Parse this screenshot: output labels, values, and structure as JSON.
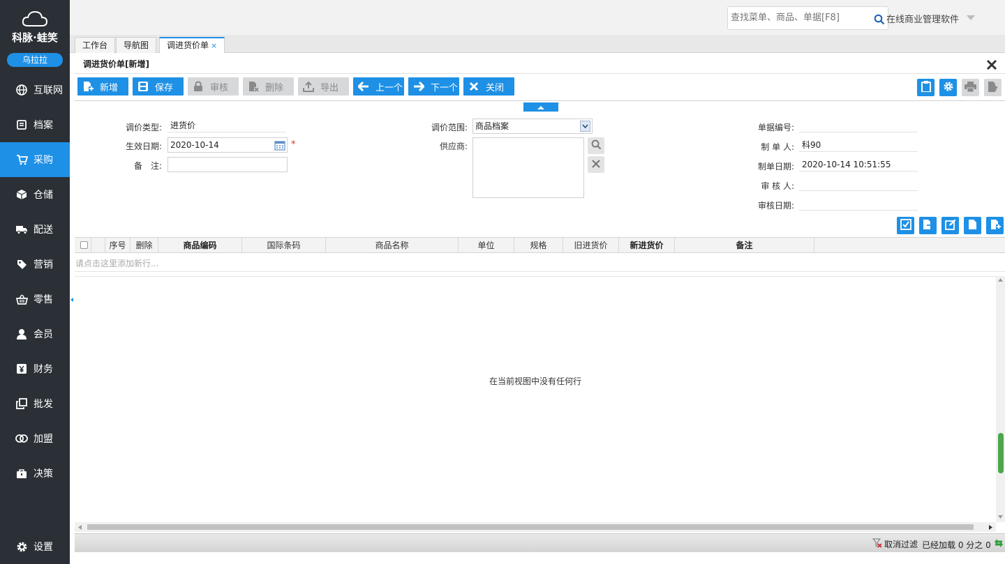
{
  "sidebar": {
    "brand": "科脉·蛙笑",
    "user": "乌拉拉",
    "items": [
      {
        "label": "互联网",
        "icon": "globe-icon"
      },
      {
        "label": "档案",
        "icon": "archive-icon"
      },
      {
        "label": "采购",
        "icon": "cart-icon",
        "active": true
      },
      {
        "label": "仓储",
        "icon": "box-icon"
      },
      {
        "label": "配送",
        "icon": "truck-icon"
      },
      {
        "label": "营销",
        "icon": "tag-icon"
      },
      {
        "label": "零售",
        "icon": "basket-icon"
      },
      {
        "label": "会员",
        "icon": "user-icon"
      },
      {
        "label": "财务",
        "icon": "yen-icon"
      },
      {
        "label": "批发",
        "icon": "copy-icon"
      },
      {
        "label": "加盟",
        "icon": "rings-icon"
      },
      {
        "label": "决策",
        "icon": "briefcase-icon"
      }
    ],
    "settings": "设置"
  },
  "header": {
    "search_placeholder": "查找菜单、商品、单据[F8]",
    "app_name": "在线商业管理软件"
  },
  "tabs": [
    {
      "label": "工作台"
    },
    {
      "label": "导航图"
    },
    {
      "label": "调进货价单",
      "close": "×"
    }
  ],
  "form": {
    "title": "调进货价单[新增]",
    "toolbar": {
      "new": "新增",
      "save": "保存",
      "audit": "审核",
      "delete": "删除",
      "export": "导出",
      "prev": "上一个",
      "next": "下一个",
      "close": "关闭"
    },
    "fields": {
      "price_type_label": "调价类型:",
      "price_type_value": "进货价",
      "effective_date_label": "生效日期:",
      "effective_date_value": "2020-10-14",
      "required_mark": "*",
      "remark_label": "备　注:",
      "remark_value": "",
      "scope_label": "调价范围:",
      "scope_value": "商品档案",
      "supplier_label": "供应商:",
      "doc_no_label": "单据编号:",
      "doc_no_value": "",
      "creator_label": "制 单 人:",
      "creator_value": "科90",
      "create_date_label": "制单日期:",
      "create_date_value": "2020-10-14 10:51:55",
      "auditor_label": "审 核 人:",
      "auditor_value": "",
      "audit_date_label": "审核日期:",
      "audit_date_value": ""
    }
  },
  "grid": {
    "columns": [
      "序号",
      "删除",
      "商品编码",
      "国际条码",
      "商品名称",
      "单位",
      "规格",
      "旧进货价",
      "新进货价",
      "备注"
    ],
    "add_row_hint": "请点击这里添加新行...",
    "empty_message": "在当前视图中没有任何行"
  },
  "status": {
    "clear_filter": "取消过滤",
    "loaded": "已经加载 0 分之 0"
  }
}
